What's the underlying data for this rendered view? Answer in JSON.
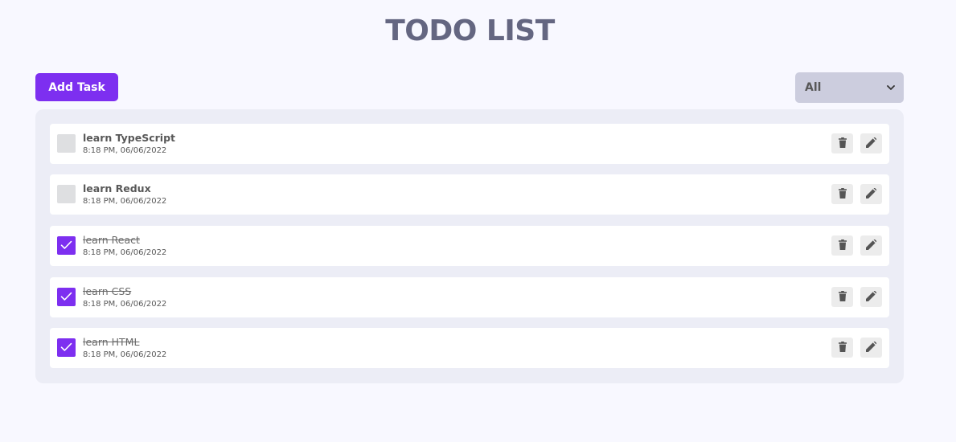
{
  "header": {
    "title": "TODO LIST"
  },
  "toolbar": {
    "add_label": "Add Task",
    "filter_value": "All"
  },
  "todos": [
    {
      "title": "learn TypeScript",
      "time": "8:18 PM, 06/06/2022",
      "completed": false
    },
    {
      "title": "learn Redux",
      "time": "8:18 PM, 06/06/2022",
      "completed": false
    },
    {
      "title": "learn React",
      "time": "8:18 PM, 06/06/2022",
      "completed": true
    },
    {
      "title": "learn CSS",
      "time": "8:18 PM, 06/06/2022",
      "completed": true
    },
    {
      "title": "learn HTML",
      "time": "8:18 PM, 06/06/2022",
      "completed": true
    }
  ],
  "colors": {
    "accent": "#7d2ff0",
    "title": "#646681",
    "background": "#f8f8ff",
    "panel": "#ecedf6",
    "select": "#cccdde",
    "icon_button": "#ececec",
    "text": "#585858"
  },
  "icons": {
    "delete": "trash-icon",
    "edit": "pencil-icon",
    "check": "check-icon",
    "dropdown": "chevron-down-icon"
  }
}
